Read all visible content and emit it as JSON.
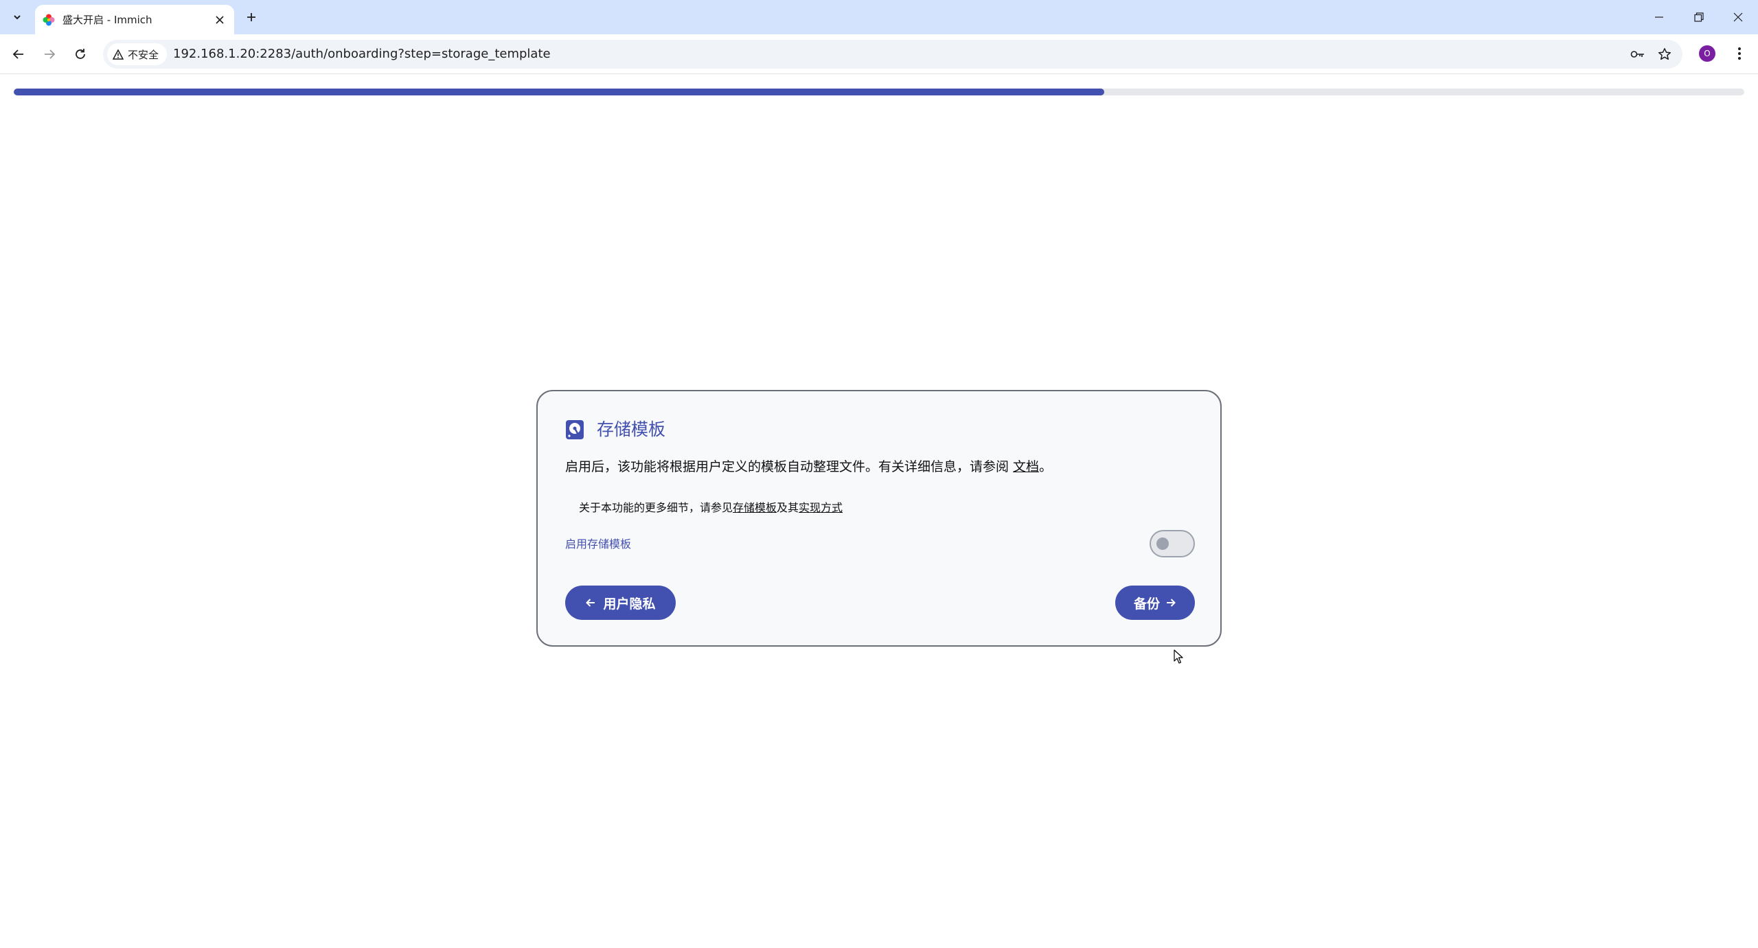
{
  "browser": {
    "tab": {
      "title": "盛大开启 - Immich"
    },
    "toolbar": {
      "security_label": "不安全",
      "url": "192.168.1.20:2283/auth/onboarding?step=storage_template",
      "profile_initial": "O"
    }
  },
  "onboarding": {
    "progress_fraction": 0.63,
    "card": {
      "title": "存储模板",
      "description": "启用后，该功能将根据用户定义的模板自动整理文件。有关详细信息，请参阅 ",
      "doc_link": "文档",
      "description_end": "。",
      "details_prefix": "关于本功能的更多细节，请参见",
      "details_link_1": "存储模板",
      "details_middle": "及其",
      "details_link_2": "实现方式",
      "toggle_label": "启用存储模板",
      "toggle_enabled": false,
      "back_button": "用户隐私",
      "next_button": "备份"
    }
  },
  "colors": {
    "accent": "#4250af",
    "tabstrip": "#d3e3fd"
  }
}
